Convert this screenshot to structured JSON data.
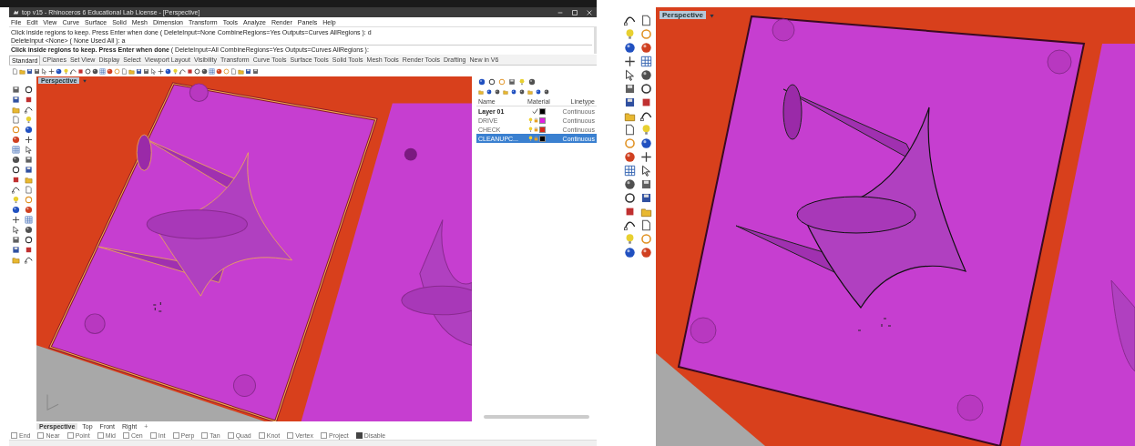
{
  "left_window": {
    "title": "top v15 - Rhinoceros 6 Educational Lab License - [Perspective]",
    "menu": [
      "File",
      "Edit",
      "View",
      "Curve",
      "Surface",
      "Solid",
      "Mesh",
      "Dimension",
      "Transform",
      "Tools",
      "Analyze",
      "Render",
      "Panels",
      "Help"
    ],
    "command_lines": [
      "Click inside regions to keep. Press Enter when done ( DeleteInput=None  CombineRegions=Yes  Outputs=Curves  AllRegions ): d",
      "DeleteInput <None> ( None  Used  All ): a",
      "**Click inside regions to keep. Press Enter when done** ( DeleteInput=All  CombineRegions=Yes  Outputs=Curves  AllRegions ):"
    ],
    "toolbar_tabs": [
      {
        "label": "Standard",
        "selected": true
      },
      {
        "label": "CPlanes",
        "selected": false
      },
      {
        "label": "Set View",
        "selected": false
      },
      {
        "label": "Display",
        "selected": false
      },
      {
        "label": "Select",
        "selected": false
      },
      {
        "label": "Viewport Layout",
        "selected": false
      },
      {
        "label": "Visibility",
        "selected": false
      },
      {
        "label": "Transform",
        "selected": false
      },
      {
        "label": "Curve Tools",
        "selected": false
      },
      {
        "label": "Surface Tools",
        "selected": false
      },
      {
        "label": "Solid Tools",
        "selected": false
      },
      {
        "label": "Mesh Tools",
        "selected": false
      },
      {
        "label": "Render Tools",
        "selected": false
      },
      {
        "label": "Drafting",
        "selected": false
      },
      {
        "label": "New in V6",
        "selected": false
      }
    ],
    "viewport": {
      "label": "Perspective"
    },
    "layers": {
      "columns": [
        "Name",
        "Material",
        "Linetype"
      ],
      "rows": [
        {
          "name": "Layer 01",
          "current": true,
          "color": "#000000",
          "linetype": "Continuous",
          "selected": false
        },
        {
          "name": "DRIVE",
          "current": false,
          "color": "#e020e0",
          "linetype": "Continuous",
          "selected": false
        },
        {
          "name": "CHECK",
          "current": false,
          "color": "#d82818",
          "linetype": "Continuous",
          "selected": false
        },
        {
          "name": "CLEANUPC...",
          "current": false,
          "color": "#000000",
          "linetype": "Continuous",
          "selected": true
        }
      ]
    },
    "viewport_tabs": [
      {
        "label": "Perspective",
        "selected": true
      },
      {
        "label": "Top",
        "selected": false
      },
      {
        "label": "Front",
        "selected": false
      },
      {
        "label": "Right",
        "selected": false
      }
    ],
    "add_tab": "+",
    "osnaps": [
      {
        "label": "End",
        "checked": false
      },
      {
        "label": "Near",
        "checked": false
      },
      {
        "label": "Point",
        "checked": false
      },
      {
        "label": "Mid",
        "checked": false
      },
      {
        "label": "Cen",
        "checked": false
      },
      {
        "label": "Int",
        "checked": false
      },
      {
        "label": "Perp",
        "checked": false
      },
      {
        "label": "Tan",
        "checked": false
      },
      {
        "label": "Quad",
        "checked": false
      },
      {
        "label": "Knot",
        "checked": false
      },
      {
        "label": "Vertex",
        "checked": false
      },
      {
        "label": "Project",
        "checked": false
      },
      {
        "label": "Disable",
        "checked": true
      }
    ]
  },
  "right_window": {
    "viewport": {
      "label": "Perspective"
    }
  }
}
